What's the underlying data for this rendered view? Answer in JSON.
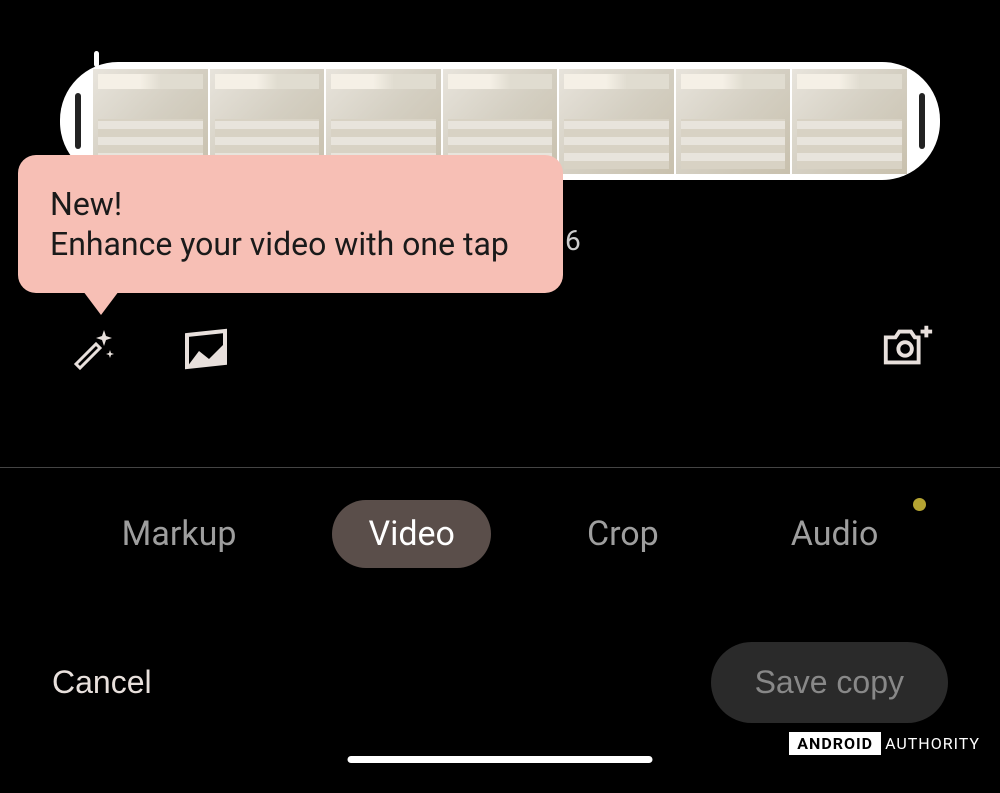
{
  "timeline": {
    "thumbnails_count": 7
  },
  "tooltip": {
    "title": "New!",
    "text": "Enhance your video with one tap"
  },
  "behind_label": "6",
  "icons": {
    "magic_wand": "magic-wand-icon",
    "photo_frame": "photo-frame-icon",
    "camera_add": "camera-add-icon"
  },
  "tabs": {
    "items": [
      {
        "label": "Markup",
        "active": false,
        "has_dot": false
      },
      {
        "label": "Video",
        "active": true,
        "has_dot": false
      },
      {
        "label": "Crop",
        "active": false,
        "has_dot": false
      },
      {
        "label": "Audio",
        "active": false,
        "has_dot": true
      }
    ]
  },
  "actions": {
    "cancel": "Cancel",
    "save": "Save copy"
  },
  "watermark": {
    "brand": "ANDROID",
    "suffix": "AUTHORITY"
  }
}
